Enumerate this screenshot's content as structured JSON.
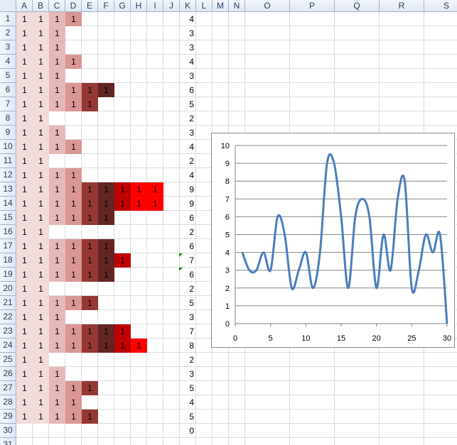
{
  "spreadsheet": {
    "columns": [
      "A",
      "B",
      "C",
      "D",
      "E",
      "F",
      "G",
      "H",
      "I",
      "J",
      "K",
      "L",
      "M",
      "N",
      "O",
      "P",
      "Q",
      "R",
      "S"
    ],
    "rows": [
      "1",
      "2",
      "3",
      "4",
      "5",
      "6",
      "7",
      "8",
      "9",
      "10",
      "11",
      "12",
      "13",
      "14",
      "15",
      "16",
      "17",
      "18",
      "19",
      "20",
      "21",
      "22",
      "23",
      "24",
      "25",
      "26",
      "27",
      "28",
      "29",
      "30",
      "31"
    ],
    "fill_colors": {
      "A": "#f2dcdb",
      "B": "#f2dcdb",
      "C": "#e6b8b7",
      "D": "#d99694",
      "E": "#953735",
      "F": "#632523",
      "G": "#c00000",
      "H": "#ff0000",
      "I": "#ff0000"
    },
    "cell_value": "1",
    "row_counts": [
      4,
      3,
      3,
      4,
      3,
      6,
      5,
      2,
      3,
      4,
      2,
      4,
      9,
      9,
      6,
      2,
      6,
      7,
      6,
      2,
      5,
      3,
      7,
      8,
      2,
      3,
      5,
      4,
      5,
      0
    ],
    "k_values": [
      "4",
      "3",
      "3",
      "4",
      "3",
      "6",
      "5",
      "2",
      "3",
      "4",
      "2",
      "4",
      "9",
      "9",
      "6",
      "2",
      "6",
      "7",
      "6",
      "2",
      "5",
      "3",
      "7",
      "8",
      "2",
      "3",
      "5",
      "4",
      "5",
      "0"
    ]
  },
  "chart_data": {
    "type": "line",
    "smoothed": true,
    "x": [
      1,
      2,
      3,
      4,
      5,
      6,
      7,
      8,
      9,
      10,
      11,
      12,
      13,
      14,
      15,
      16,
      17,
      18,
      19,
      20,
      21,
      22,
      23,
      24,
      25,
      26,
      27,
      28,
      29,
      30
    ],
    "series": [
      {
        "values": [
          4,
          3,
          3,
          4,
          3,
          6,
          5,
          2,
          3,
          4,
          2,
          4,
          9,
          9,
          6,
          2,
          6,
          7,
          6,
          2,
          5,
          3,
          7,
          8,
          2,
          3,
          5,
          4,
          5,
          0
        ],
        "color": "#4a7ebb"
      }
    ],
    "xlim": [
      0,
      30
    ],
    "ylim": [
      0,
      10
    ],
    "xticks": [
      "0",
      "5",
      "10",
      "15",
      "20",
      "25",
      "30"
    ],
    "yticks": [
      "0",
      "1",
      "2",
      "3",
      "4",
      "5",
      "6",
      "7",
      "8",
      "9",
      "10"
    ],
    "grid": "horizontal",
    "legend": "none",
    "title": "",
    "xlabel": "",
    "ylabel": ""
  }
}
